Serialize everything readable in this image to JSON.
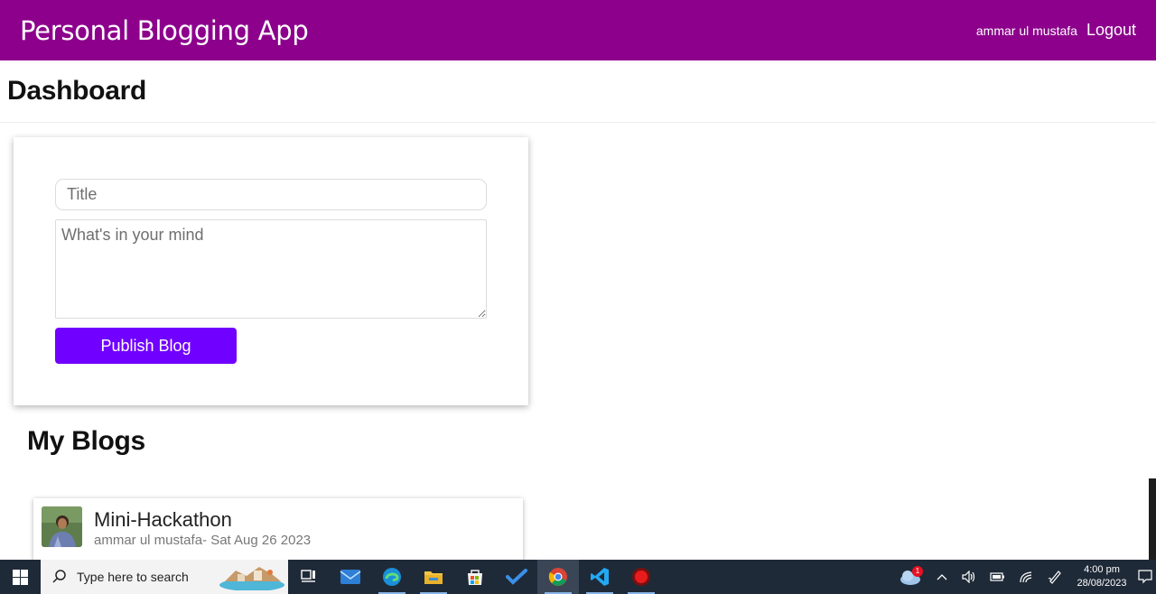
{
  "navbar": {
    "brand": "Personal Blogging App",
    "user_name": "ammar ul mustafa",
    "logout_label": "Logout",
    "color": "#8c008c"
  },
  "header": {
    "title": "Dashboard"
  },
  "composer": {
    "title_placeholder": "Title",
    "body_placeholder": "What's in your mind",
    "publish_label": "Publish Blog",
    "button_color": "#7000ff"
  },
  "my_blogs": {
    "title": "My Blogs",
    "items": [
      {
        "title": "Mini-Hackathon",
        "meta": "ammar ul mustafa- Sat Aug 26 2023",
        "avatar_icon": "user-photo"
      }
    ]
  },
  "taskbar": {
    "search_placeholder": "Type here to search",
    "apps": [
      "task-view-icon",
      "mail-icon",
      "edge-icon",
      "file-explorer-icon",
      "store-icon",
      "todo-icon",
      "chrome-icon",
      "vscode-icon",
      "record-icon"
    ],
    "weather_badge": "1",
    "time": "4:00 pm",
    "date": "28/08/2023"
  }
}
